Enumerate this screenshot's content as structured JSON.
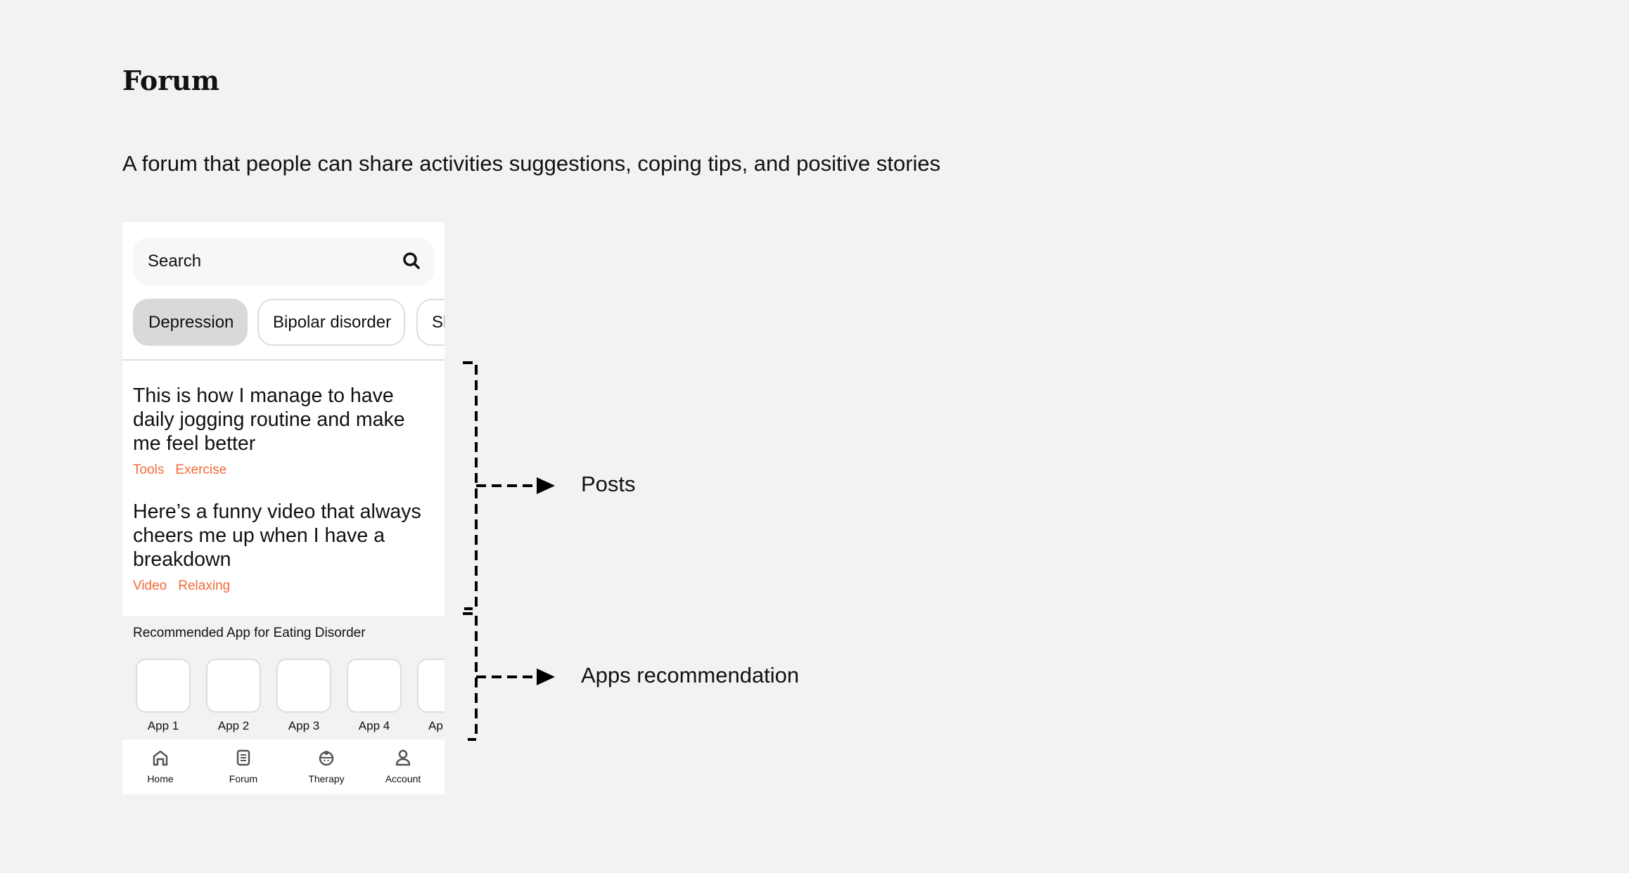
{
  "title": "Forum",
  "subtitle": "A forum that people can share activities suggestions, coping tips, and positive stories",
  "search": {
    "placeholder": "Search",
    "icon": "search-icon"
  },
  "chips": [
    {
      "label": "Depression",
      "active": true
    },
    {
      "label": "Bipolar disorder",
      "active": false
    },
    {
      "label": "Sl",
      "active": false
    }
  ],
  "posts": [
    {
      "title": "This is how I manage to have daily jogging routine and make me feel better",
      "tags": [
        "Tools",
        "Exercise"
      ]
    },
    {
      "title": "Here’s a funny video that always cheers me up when I have a breakdown",
      "tags": [
        "Video",
        "Relaxing"
      ]
    }
  ],
  "recommended": {
    "heading": "Recommended App for Eating Disorder",
    "apps": [
      "App 1",
      "App 2",
      "App 3",
      "App 4",
      "Ap"
    ]
  },
  "nav": [
    {
      "label": "Home",
      "icon": "home-icon"
    },
    {
      "label": "Forum",
      "icon": "forum-icon"
    },
    {
      "label": "Therapy",
      "icon": "therapy-icon"
    },
    {
      "label": "Account",
      "icon": "account-icon"
    }
  ],
  "annotations": {
    "posts": "Posts",
    "apps": "Apps recommendation"
  },
  "colors": {
    "tag": "#f26b3a",
    "background": "#f2f2f2"
  }
}
